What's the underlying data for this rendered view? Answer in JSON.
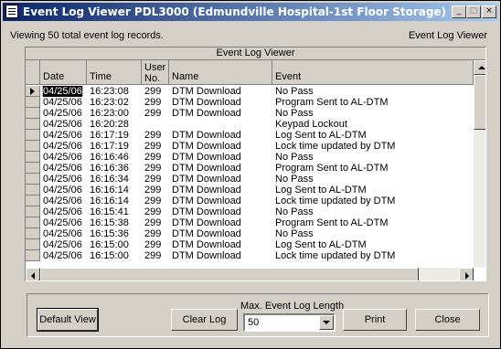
{
  "window": {
    "title": "Event Log Viewer PDL3000 (Edmundville Hospital-1st Floor Storage)",
    "controls": {
      "minimize": "_",
      "maximize": "□",
      "close": "×"
    }
  },
  "status": {
    "viewing": "Viewing 50 total event log records.",
    "heading_right": "Event Log Viewer"
  },
  "grid": {
    "caption": "Event Log Viewer",
    "columns": {
      "date": "Date",
      "time": "Time",
      "user": "User No.",
      "name": "Name",
      "event": "Event"
    },
    "rows": [
      {
        "date": "04/25/06",
        "time": "16:23:08",
        "user": "299",
        "name": "DTM Download",
        "event": "No Pass"
      },
      {
        "date": "04/25/06",
        "time": "16:23:02",
        "user": "299",
        "name": "DTM Download",
        "event": "Program Sent to AL-DTM"
      },
      {
        "date": "04/25/06",
        "time": "16:23:00",
        "user": "299",
        "name": "DTM Download",
        "event": "No Pass"
      },
      {
        "date": "04/25/06",
        "time": "16:20:28",
        "user": "",
        "name": "",
        "event": "Keypad Lockout"
      },
      {
        "date": "04/25/06",
        "time": "16:17:19",
        "user": "299",
        "name": "DTM Download",
        "event": "Log Sent to AL-DTM"
      },
      {
        "date": "04/25/06",
        "time": "16:17:19",
        "user": "299",
        "name": "DTM Download",
        "event": "Lock time updated by DTM"
      },
      {
        "date": "04/25/06",
        "time": "16:16:46",
        "user": "299",
        "name": "DTM Download",
        "event": "No Pass"
      },
      {
        "date": "04/25/06",
        "time": "16:16:36",
        "user": "299",
        "name": "DTM Download",
        "event": "Program Sent to AL-DTM"
      },
      {
        "date": "04/25/06",
        "time": "16:16:34",
        "user": "299",
        "name": "DTM Download",
        "event": "No Pass"
      },
      {
        "date": "04/25/06",
        "time": "16:16:14",
        "user": "299",
        "name": "DTM Download",
        "event": "Log Sent to AL-DTM"
      },
      {
        "date": "04/25/06",
        "time": "16:16:14",
        "user": "299",
        "name": "DTM Download",
        "event": "Lock time updated by DTM"
      },
      {
        "date": "04/25/06",
        "time": "16:15:41",
        "user": "299",
        "name": "DTM Download",
        "event": "No Pass"
      },
      {
        "date": "04/25/06",
        "time": "16:15:38",
        "user": "299",
        "name": "DTM Download",
        "event": "Program Sent to AL-DTM"
      },
      {
        "date": "04/25/06",
        "time": "16:15:36",
        "user": "299",
        "name": "DTM Download",
        "event": "No Pass"
      },
      {
        "date": "04/25/06",
        "time": "16:15:00",
        "user": "299",
        "name": "DTM Download",
        "event": "Log Sent to AL-DTM"
      },
      {
        "date": "04/25/06",
        "time": "16:15:00",
        "user": "299",
        "name": "DTM Download",
        "event": "Lock time updated by DTM"
      }
    ]
  },
  "buttons": {
    "default_view": "Default View",
    "clear_log": "Clear Log",
    "print": "Print",
    "close": "Close"
  },
  "max_event_log": {
    "label": "Max. Event Log  Length",
    "selected": "50"
  }
}
